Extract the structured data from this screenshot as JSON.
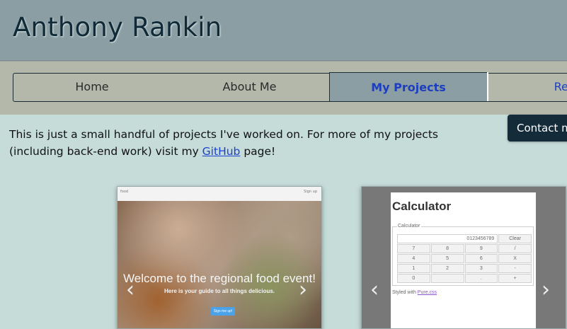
{
  "header": {
    "title": "Anthony Rankin"
  },
  "nav": {
    "tabs": [
      {
        "label": "Home"
      },
      {
        "label": "About Me"
      },
      {
        "label": "My Projects"
      },
      {
        "label": "Resu"
      }
    ]
  },
  "content": {
    "intro_before": "This is just a small handful of projects I've worked on. For more of my projects (including back-end work) visit my ",
    "github_link": "GitHub",
    "intro_after": " page!"
  },
  "contact_button": "Contact m",
  "carousel_food": {
    "topbar_left": "food",
    "topbar_right": "Sign up",
    "heading": "Welcome to the regional food event!",
    "subheading": "Here is your guide to all things delicious.",
    "button": "Sign me up!",
    "prev_icon": "chevron-left-icon",
    "next_icon": "chevron-right-icon"
  },
  "carousel_calc": {
    "title": "Calculator",
    "legend": "Calculator",
    "display": "0123456789",
    "clear": "Clear",
    "keys": [
      "7",
      "8",
      "9",
      "/",
      "4",
      "5",
      "6",
      "X",
      "1",
      "2",
      "3",
      "-",
      "0",
      "",
      ".",
      "+"
    ],
    "styled_prefix": "Styled with ",
    "styled_link": "Pure.css",
    "prev_icon": "chevron-left-icon",
    "next_icon": "chevron-right-icon"
  },
  "colors": {
    "header_bg": "#8a9ea3",
    "nav_bg": "#b4b8ab",
    "page_bg": "#c5dcd9",
    "active_tab_text": "#1d3fbf",
    "contact_bg": "#142b3a"
  }
}
